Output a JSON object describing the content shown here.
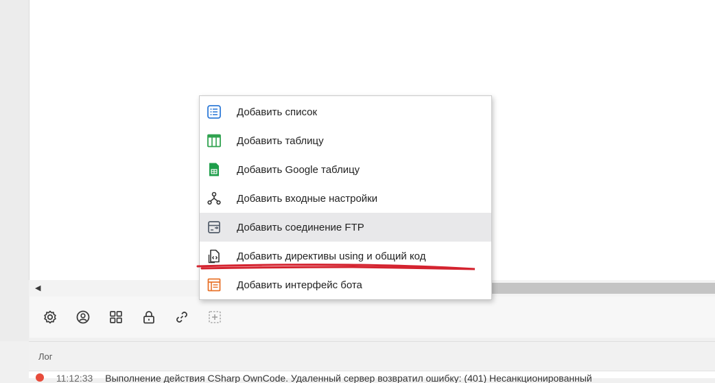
{
  "menu": {
    "items": [
      {
        "label": "Добавить список",
        "icon": "list-icon"
      },
      {
        "label": "Добавить таблицу",
        "icon": "table-icon"
      },
      {
        "label": "Добавить Google таблицу",
        "icon": "google-sheets-icon"
      },
      {
        "label": "Добавить входные настройки",
        "icon": "input-settings-icon"
      },
      {
        "label": "Добавить соединение FTP",
        "icon": "ftp-icon"
      },
      {
        "label": "Добавить директивы using и общий код",
        "icon": "code-file-icon"
      },
      {
        "label": "Добавить интерфейс бота",
        "icon": "bot-interface-icon"
      }
    ],
    "hovered_index": 4,
    "annotated_index": 5
  },
  "toolbar": {
    "icons": [
      "settings-icon",
      "user-circle-icon",
      "grid-icon",
      "lock-icon",
      "link-icon",
      "add-box-icon"
    ]
  },
  "hscroll": {
    "left_arrow": "◀"
  },
  "log": {
    "title": "Лог",
    "line": {
      "time": "11:12:33",
      "text": "Выполнение действия CSharp OwnCode. Удаленный сервер возвратил ошибку: (401) Несанкционированный"
    }
  },
  "colors": {
    "list_icon": "#2f7bd8",
    "table_icon": "#2fa24f",
    "google_sheets_icon": "#1e9e4a",
    "ftp_icon": "#505a68",
    "bot_icon": "#e8722a",
    "annotation": "#d4232f",
    "hover_bg": "#e8e8ea"
  }
}
